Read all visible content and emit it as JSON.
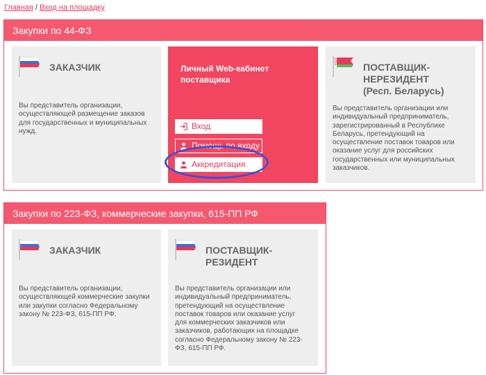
{
  "breadcrumb": {
    "home": "Главная",
    "separator": "/",
    "current": "Вход на площадку"
  },
  "section44": {
    "header": "Закупки по 44-ФЗ",
    "customer": {
      "title": "ЗАКАЗЧИК",
      "text": "Вы представитель организации, осуществляющей размещение заказов для государственных и муниципальных нужд."
    },
    "cabinet": {
      "title": "Личный Web-кабинет поставщика",
      "login": "Вход",
      "help": "Помощь по входу",
      "accreditation": "Аккредитация"
    },
    "nonresident": {
      "title_line1": "ПОСТАВЩИК-",
      "title_line2": "НЕРЕЗИДЕНТ",
      "title_line3": "(Респ. Беларусь)",
      "text": "Вы представитель организации или индивидуальный предприниматель, зарегистрированный в Республике Беларусь, претендующий на осуществление поставок товаров или оказание услуг для российских государственных или муниципальных заказчиков."
    }
  },
  "section223": {
    "header": "Закупки по 223-ФЗ, коммерческие закупки, 615-ПП РФ",
    "customer": {
      "title": "ЗАКАЗЧИК",
      "text": "Вы представитель организации, осуществляющей коммерческие закупки или закупки согласно Федеральному закону № 223-ФЗ, 615-ПП РФ."
    },
    "resident": {
      "title_line1": "ПОСТАВЩИК-",
      "title_line2": "РЕЗИДЕНТ",
      "text": "Вы представитель организации или индивидуальный предприниматель, претендующий на осуществление поставок товаров или оказание услуг для коммерческих заказчиков или заказчиков, работающих на площадке согласно Федеральному закону № 223-ФЗ, 615-ПП РФ."
    }
  },
  "colors": {
    "accent": "#f5586f",
    "card": "#eeeeee",
    "annotation": "#3d4fd6"
  },
  "icons": [
    "russia-flag-icon",
    "belarus-flag-icon",
    "login-icon",
    "user-icon"
  ]
}
